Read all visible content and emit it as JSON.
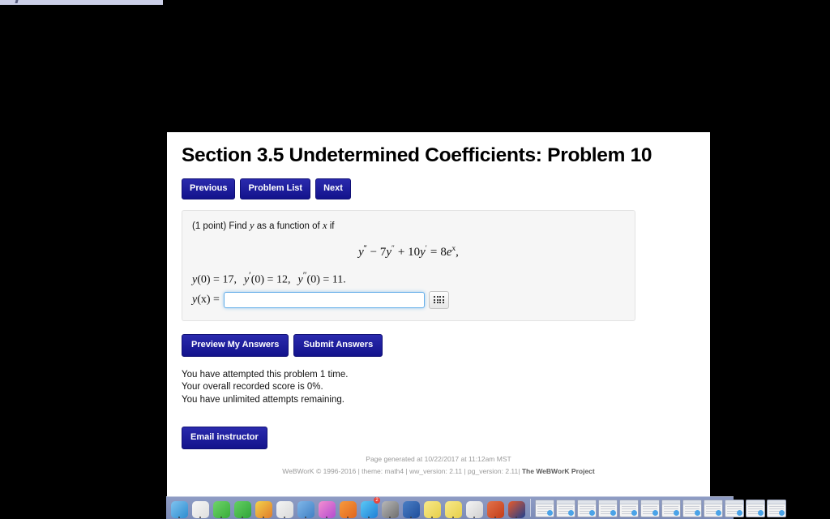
{
  "window": {
    "background_color": "#000000",
    "page_background": "#ffffff"
  },
  "header": {
    "title": "Section 3.5 Undetermined Coefficients: Problem 10"
  },
  "nav_buttons": [
    {
      "label": "Previous",
      "name": "previous-button"
    },
    {
      "label": "Problem List",
      "name": "problem-list-button"
    },
    {
      "label": "Next",
      "name": "next-button"
    }
  ],
  "problem": {
    "points_text": "(1 point) Find",
    "prompt_var_y": "y",
    "prompt_middle": "as a function of",
    "prompt_var_x": "x",
    "prompt_end": "if",
    "equation": {
      "lhs_y": "y",
      "lhs_primes": "‴",
      "minus": "− 7",
      "term2_y": "y",
      "term2_primes": "″",
      "plus": "+ 10",
      "term3_y": "y",
      "term3_primes": "′",
      "equals": "=",
      "rhs_coeff": "8",
      "rhs_e": "e",
      "rhs_exp": "x",
      "trailing": ",",
      "plain_text": "y‴ − 7y″ + 10y′ = 8e^x,"
    },
    "initial_conditions": {
      "c1_fn": "y",
      "c1_arg": "(0) = 17,",
      "c2_fn": "y",
      "c2_prime": "′",
      "c2_arg": "(0) = 12,",
      "c3_fn": "y",
      "c3_prime": "″",
      "c3_arg": "(0) = 11.",
      "plain_text": "y(0) = 17,  y′(0) = 12,  y″(0) = 11."
    },
    "answer": {
      "label_fn": "y",
      "label_arg": "(x) =",
      "value": "",
      "placeholder": "",
      "keypad_icon": "keypad-grid-icon"
    }
  },
  "submit_buttons": [
    {
      "label": "Preview My Answers",
      "name": "preview-my-answers-button"
    },
    {
      "label": "Submit Answers",
      "name": "submit-answers-button"
    }
  ],
  "status": {
    "attempts": "You have attempted this problem 1 time.",
    "score": "Your overall recorded score is 0%.",
    "remaining": "You have unlimited attempts remaining."
  },
  "email": {
    "label": "Email instructor"
  },
  "footer": {
    "generated": "Page generated at 10/22/2017 at 11:12am MST",
    "credits_left": "WeBWorK © 1996-2016 | theme: math4 | ww_version: 2.11 | pg_version: 2.11|",
    "project_link": "The WeBWorK Project"
  },
  "colors": {
    "button_navy": "#1b1b9b",
    "panel_gray": "#f6f6f6",
    "input_focus_blue": "#66afe9",
    "footer_gray": "#9a9a9a",
    "dock_blue": "#8e9cc4",
    "strip_lavender": "#ccd0e8"
  },
  "dock": {
    "apps": [
      {
        "name": "dock-icon-finder",
        "color1": "#7fc2ef",
        "color2": "#2d8dd0",
        "badge": ""
      },
      {
        "name": "dock-icon-photos",
        "color1": "#f6f6f6",
        "color2": "#dedede",
        "badge": ""
      },
      {
        "name": "dock-icon-messages",
        "color1": "#6fd36a",
        "color2": "#37ad3a",
        "badge": ""
      },
      {
        "name": "dock-icon-facetime",
        "color1": "#64cf62",
        "color2": "#2fa53a",
        "badge": ""
      },
      {
        "name": "dock-icon-keynote",
        "color1": "#f3d24b",
        "color2": "#e07b2a",
        "badge": ""
      },
      {
        "name": "dock-icon-numbers",
        "color1": "#f4f4f4",
        "color2": "#d9d9d9",
        "badge": ""
      },
      {
        "name": "dock-icon-presentation",
        "color1": "#7fb6e8",
        "color2": "#3f7fc4",
        "badge": ""
      },
      {
        "name": "dock-icon-itunes",
        "color1": "#f48fd0",
        "color2": "#b24ad0",
        "badge": ""
      },
      {
        "name": "dock-icon-ibooks",
        "color1": "#f79a3c",
        "color2": "#e0651f",
        "badge": ""
      },
      {
        "name": "dock-icon-app-store",
        "color1": "#5ac8f5",
        "color2": "#1f7fd6",
        "badge": "2"
      },
      {
        "name": "dock-icon-system-preferences",
        "color1": "#b8b8b8",
        "color2": "#6e6e6e",
        "badge": ""
      },
      {
        "name": "dock-icon-word",
        "color1": "#4a7ec4",
        "color2": "#1f4e9c",
        "badge": ""
      },
      {
        "name": "dock-icon-stickies",
        "color1": "#f8e98a",
        "color2": "#e6cf4a",
        "badge": ""
      },
      {
        "name": "dock-icon-notes",
        "color1": "#f8e98a",
        "color2": "#e6cf4a",
        "badge": ""
      },
      {
        "name": "dock-icon-chrome",
        "color1": "#f4f4f4",
        "color2": "#d0d0d0",
        "badge": ""
      },
      {
        "name": "dock-icon-powerpoint",
        "color1": "#e2724a",
        "color2": "#c33c19",
        "badge": ""
      },
      {
        "name": "dock-icon-matlab",
        "color1": "#e85a2a",
        "color2": "#1d3f8f",
        "badge": ""
      }
    ],
    "minimized_count": 12
  }
}
